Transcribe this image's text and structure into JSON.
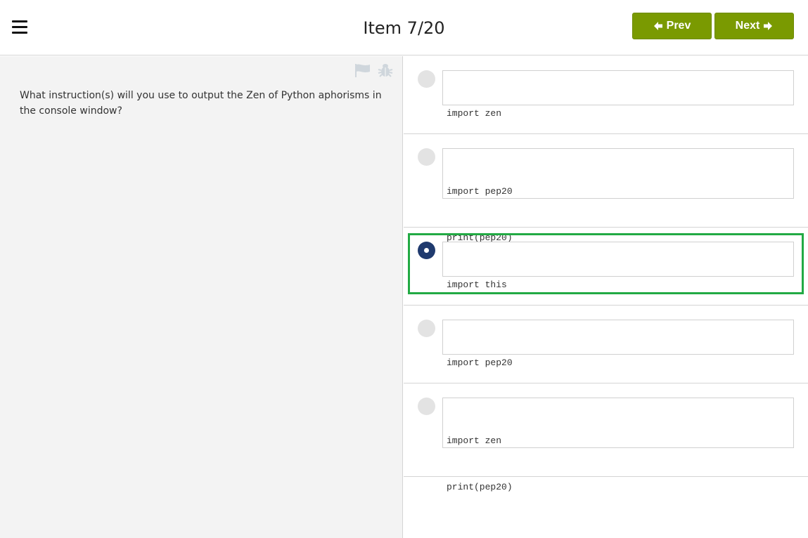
{
  "header": {
    "title": "Item 7/20",
    "prev_label": "Prev",
    "next_label": "Next"
  },
  "question": {
    "text": "What instruction(s) will you use to output the Zen of Python aphorisms in the console window?"
  },
  "options": [
    {
      "lines": [
        "import zen"
      ],
      "selected": false
    },
    {
      "lines": [
        "import pep20",
        "print(pep20)"
      ],
      "selected": false
    },
    {
      "lines": [
        "import this"
      ],
      "selected": true
    },
    {
      "lines": [
        "import pep20"
      ],
      "selected": false
    },
    {
      "lines": [
        "import zen",
        "print(pep20)"
      ],
      "selected": false
    }
  ],
  "colors": {
    "nav_button": "#7a9a01",
    "radio_selected": "#1f3a6e",
    "radio_unselected": "#e3e3e3",
    "selection_outline": "#22aa44"
  },
  "icons": {
    "menu": "hamburger-menu-icon",
    "prev": "arrow-left-icon",
    "next": "arrow-right-icon",
    "flag": "flag-icon",
    "bug": "bug-icon"
  }
}
